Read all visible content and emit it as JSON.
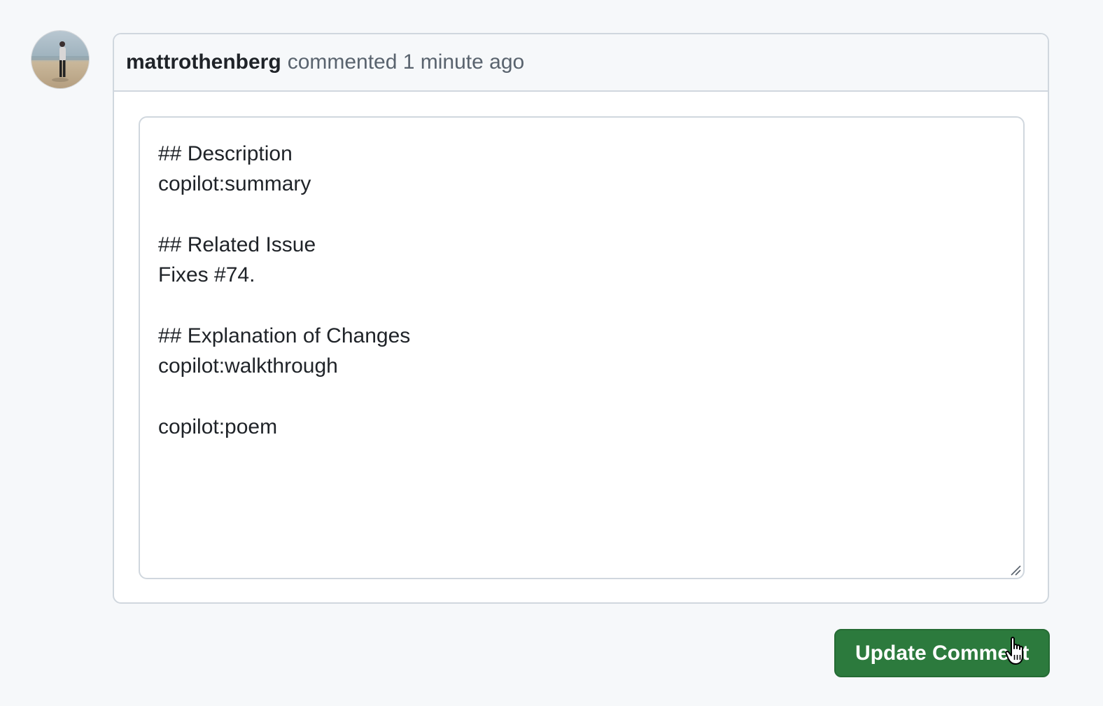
{
  "comment": {
    "author": "mattrothenberg",
    "meta": "commented 1 minute ago"
  },
  "editor": {
    "lines": [
      "## Description",
      "copilot:summary",
      "",
      "## Related Issue",
      "Fixes #74.",
      "",
      "## Explanation of Changes",
      "copilot:walkthrough",
      "",
      "copilot:poem"
    ]
  },
  "actions": {
    "update_label": "Update Comment"
  },
  "icons": {
    "avatar": "user-avatar-photo",
    "resize": "resize-handle-icon",
    "cursor": "hand-pointer-cursor-icon"
  },
  "colors": {
    "primary_button": "#2c7a3d",
    "border": "#d0d7de",
    "page_background": "#f6f8fa"
  }
}
